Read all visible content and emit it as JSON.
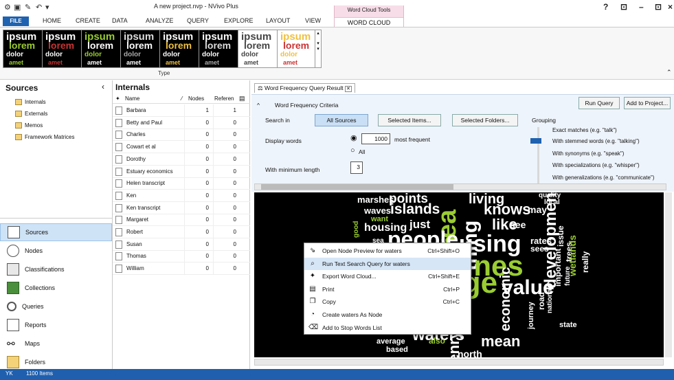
{
  "app": {
    "window_title": "A new project.nvp - NVivo Plus",
    "quick_access_icons": [
      "gear-icon",
      "save-icon",
      "edit-icon",
      "undo-icon",
      "dropdown-icon"
    ],
    "window_controls": [
      "?",
      "⊡",
      "–",
      "⊡",
      "×"
    ]
  },
  "ribbon": {
    "tabs": [
      "FILE",
      "HOME",
      "CREATE",
      "DATA",
      "ANALYZE",
      "QUERY",
      "EXPLORE",
      "LAYOUT",
      "VIEW"
    ],
    "context_group": "Word Cloud Tools",
    "context_tab": "WORD CLOUD",
    "group_label": "Type",
    "thumbnail_words": [
      "ipsum",
      "lorem",
      "dolor",
      "amet"
    ]
  },
  "sources": {
    "header": "Sources",
    "collapse": "‹",
    "tree": [
      "Internals",
      "Externals",
      "Memos",
      "Framework Matrices"
    ],
    "nav": [
      "Sources",
      "Nodes",
      "Classifications",
      "Collections",
      "Queries",
      "Reports",
      "Maps",
      "Folders"
    ]
  },
  "internals": {
    "title": "Internals",
    "columns": [
      "Name",
      "Nodes",
      "Referen"
    ],
    "rows": [
      {
        "name": "Barbara",
        "nodes": "1",
        "refs": "1"
      },
      {
        "name": "Betty and Paul",
        "nodes": "0",
        "refs": "0"
      },
      {
        "name": "Charles",
        "nodes": "0",
        "refs": "0"
      },
      {
        "name": "Cowart et al",
        "nodes": "0",
        "refs": "0"
      },
      {
        "name": "Dorothy",
        "nodes": "0",
        "refs": "0"
      },
      {
        "name": "Estuary economics",
        "nodes": "0",
        "refs": "0"
      },
      {
        "name": "Helen transcript",
        "nodes": "0",
        "refs": "0"
      },
      {
        "name": "Ken",
        "nodes": "0",
        "refs": "0"
      },
      {
        "name": "Ken transcript",
        "nodes": "0",
        "refs": "0"
      },
      {
        "name": "Margaret",
        "nodes": "0",
        "refs": "0"
      },
      {
        "name": "Robert",
        "nodes": "0",
        "refs": "0"
      },
      {
        "name": "Susan",
        "nodes": "0",
        "refs": "0"
      },
      {
        "name": "Thomas",
        "nodes": "0",
        "refs": "0"
      },
      {
        "name": "William",
        "nodes": "0",
        "refs": "0"
      }
    ]
  },
  "query": {
    "tab_label": "Word Frequency Query Result",
    "criteria_label": "Word Frequency Criteria",
    "run_query": "Run Query",
    "add_to_project": "Add to Project...",
    "search_in_label": "Search in",
    "all_sources": "All Sources",
    "selected_items": "Selected Items...",
    "selected_folders": "Selected Folders...",
    "display_words_label": "Display words",
    "most_frequent_value": "1000",
    "most_frequent_label": "most frequent",
    "all_label": "All",
    "min_length_label": "With minimum length",
    "min_length_value": "3",
    "grouping_label": "Grouping",
    "grouping_options": [
      "Exact matches (e.g. \"talk\")",
      "With stemmed words (e.g. \"talking\")",
      "With synonyms (e.g. \"speak\")",
      "With specializations (e.g. \"whisper\")",
      "With generalizations (e.g. \"communicate\")"
    ]
  },
  "cloud_words": [
    "marshes",
    "points",
    "area",
    "living",
    "quality",
    "local",
    "waves",
    "islands",
    "fish",
    "knows",
    "may",
    "good",
    "want",
    "housing",
    "just",
    "like",
    "see",
    "issue",
    "thing",
    "sea",
    "people",
    "using",
    "rates",
    "sees",
    "trees",
    "lines",
    "developments",
    "really",
    "wetlands",
    "important",
    "value",
    "change",
    "economic",
    "future",
    "national",
    "total",
    "road",
    "journey",
    "state",
    "water",
    "waters",
    "mean",
    "henry",
    "average",
    "based",
    "also",
    "north"
  ],
  "context_menu": [
    {
      "label": "Open Node Preview for waters",
      "shortcut": "Ctrl+Shift+O",
      "icon": "node-preview-icon"
    },
    {
      "label": "Run Text Search Query for waters",
      "shortcut": "",
      "icon": "text-search-icon"
    },
    {
      "label": "Export Word Cloud...",
      "shortcut": "Ctrl+Shift+E",
      "icon": "export-icon"
    },
    {
      "label": "Print",
      "shortcut": "Ctrl+P",
      "icon": "print-icon"
    },
    {
      "label": "Copy",
      "shortcut": "Ctrl+C",
      "icon": "copy-icon"
    },
    {
      "label": "Create waters As Node",
      "shortcut": "",
      "icon": "create-node-icon"
    },
    {
      "label": "Add to Stop Words List",
      "shortcut": "",
      "icon": "stop-words-icon"
    }
  ],
  "status": {
    "user": "YK",
    "items": "1100 Items"
  },
  "colors": {
    "accent": "#1e62b0",
    "cloud_green": "#9acd32",
    "cloud_white": "#ffffff",
    "cloud_grey": "#b8b8b8",
    "context_tab": "#f7dde8"
  }
}
